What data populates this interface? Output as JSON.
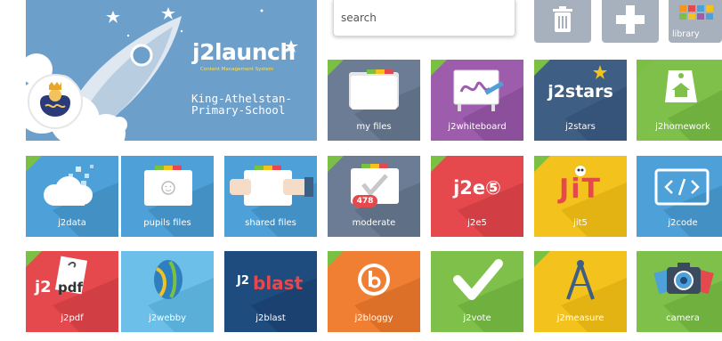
{
  "hero": {
    "title": "j2launch",
    "subtitle": "Content Management System",
    "school": "King-Athelstan-Primary-School"
  },
  "search": {
    "placeholder": "search"
  },
  "actions": {
    "library_label": "library"
  },
  "tiles": [
    {
      "label": "my files"
    },
    {
      "label": "j2whiteboard"
    },
    {
      "label": "j2stars"
    },
    {
      "label": "j2homework"
    },
    {
      "label": "j2data"
    },
    {
      "label": "pupils files"
    },
    {
      "label": "shared files"
    },
    {
      "label": "moderate"
    },
    {
      "label": "j2e5"
    },
    {
      "label": "jit5"
    },
    {
      "label": "j2code"
    },
    {
      "label": "j2pdf"
    },
    {
      "label": "j2webby"
    },
    {
      "label": "j2blast"
    },
    {
      "label": "j2bloggy"
    },
    {
      "label": "j2vote"
    },
    {
      "label": "j2measure"
    },
    {
      "label": "camera"
    }
  ],
  "badges": {
    "moderate_count": "478"
  },
  "icon_text": {
    "j2stars": "j2stars",
    "j2e5": "j2e⑤",
    "jit": "JiT",
    "j2pdf_prefix": "j2",
    "j2pdf_suffix": "pdf",
    "j2blast_prefix": "J2",
    "j2blast_suffix": "blast"
  },
  "colors": {
    "hero_bg": "#6d9fcb",
    "flag_green": "#7ac143",
    "tile_grey": "#6b7c94",
    "tile_purple": "#9e5cad",
    "tile_navy": "#3e5e84",
    "tile_green": "#7ec04a",
    "tile_blue": "#4da1d8",
    "tile_red": "#e5484d",
    "tile_yellow": "#f4c21d",
    "tile_orange": "#f07f34"
  }
}
